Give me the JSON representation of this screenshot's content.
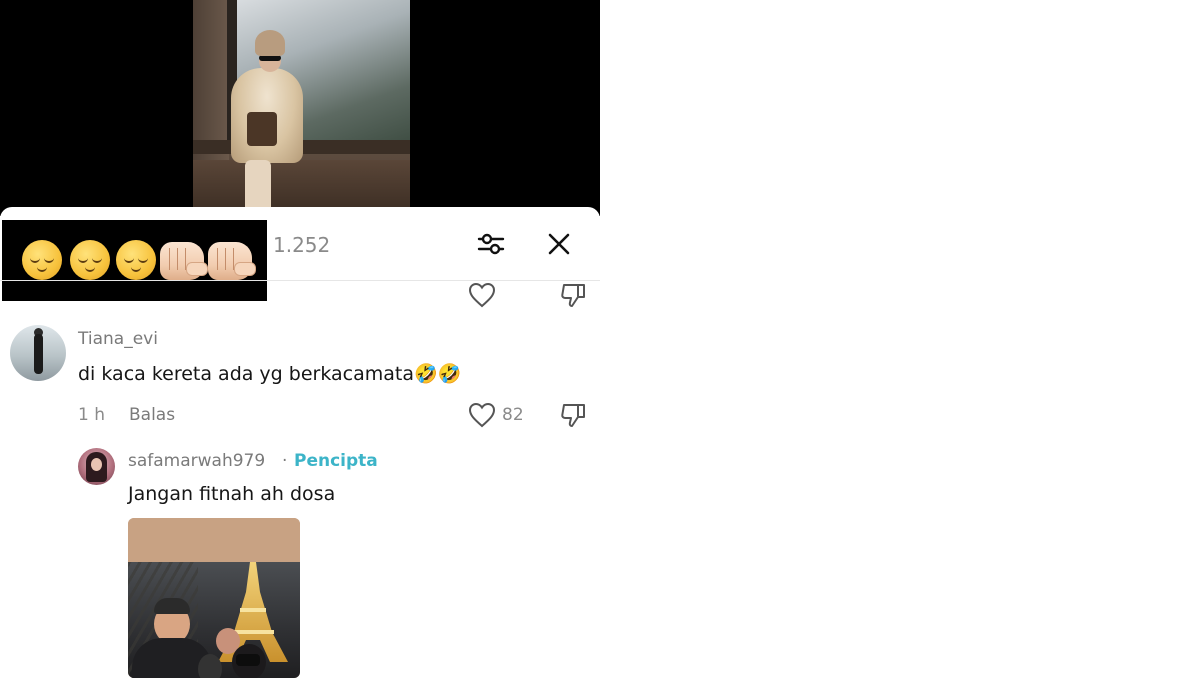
{
  "header": {
    "comment_count": "1.252",
    "filter_icon": "sliders-icon",
    "close_icon": "close-icon"
  },
  "overlay": {
    "emojis": [
      "relieved-face-emoji",
      "relieved-face-emoji",
      "relieved-face-emoji",
      "fist-pointing-emoji",
      "fist-pointing-emoji"
    ]
  },
  "comments": [
    {
      "username": "Tiana_evi",
      "text": "di kaca kereta ada yg berkacamata🤣🤣",
      "time": "1 h",
      "reply_label": "Balas",
      "likes": "82"
    }
  ],
  "reply": {
    "username": "safamarwah979",
    "separator": "·",
    "creator_badge": "Pencipta",
    "text": "Jangan fitnah ah dosa"
  },
  "colors": {
    "creator_badge": "#3cb4c8",
    "meta_gray": "#8a8a8a",
    "text_dark": "#161616"
  }
}
